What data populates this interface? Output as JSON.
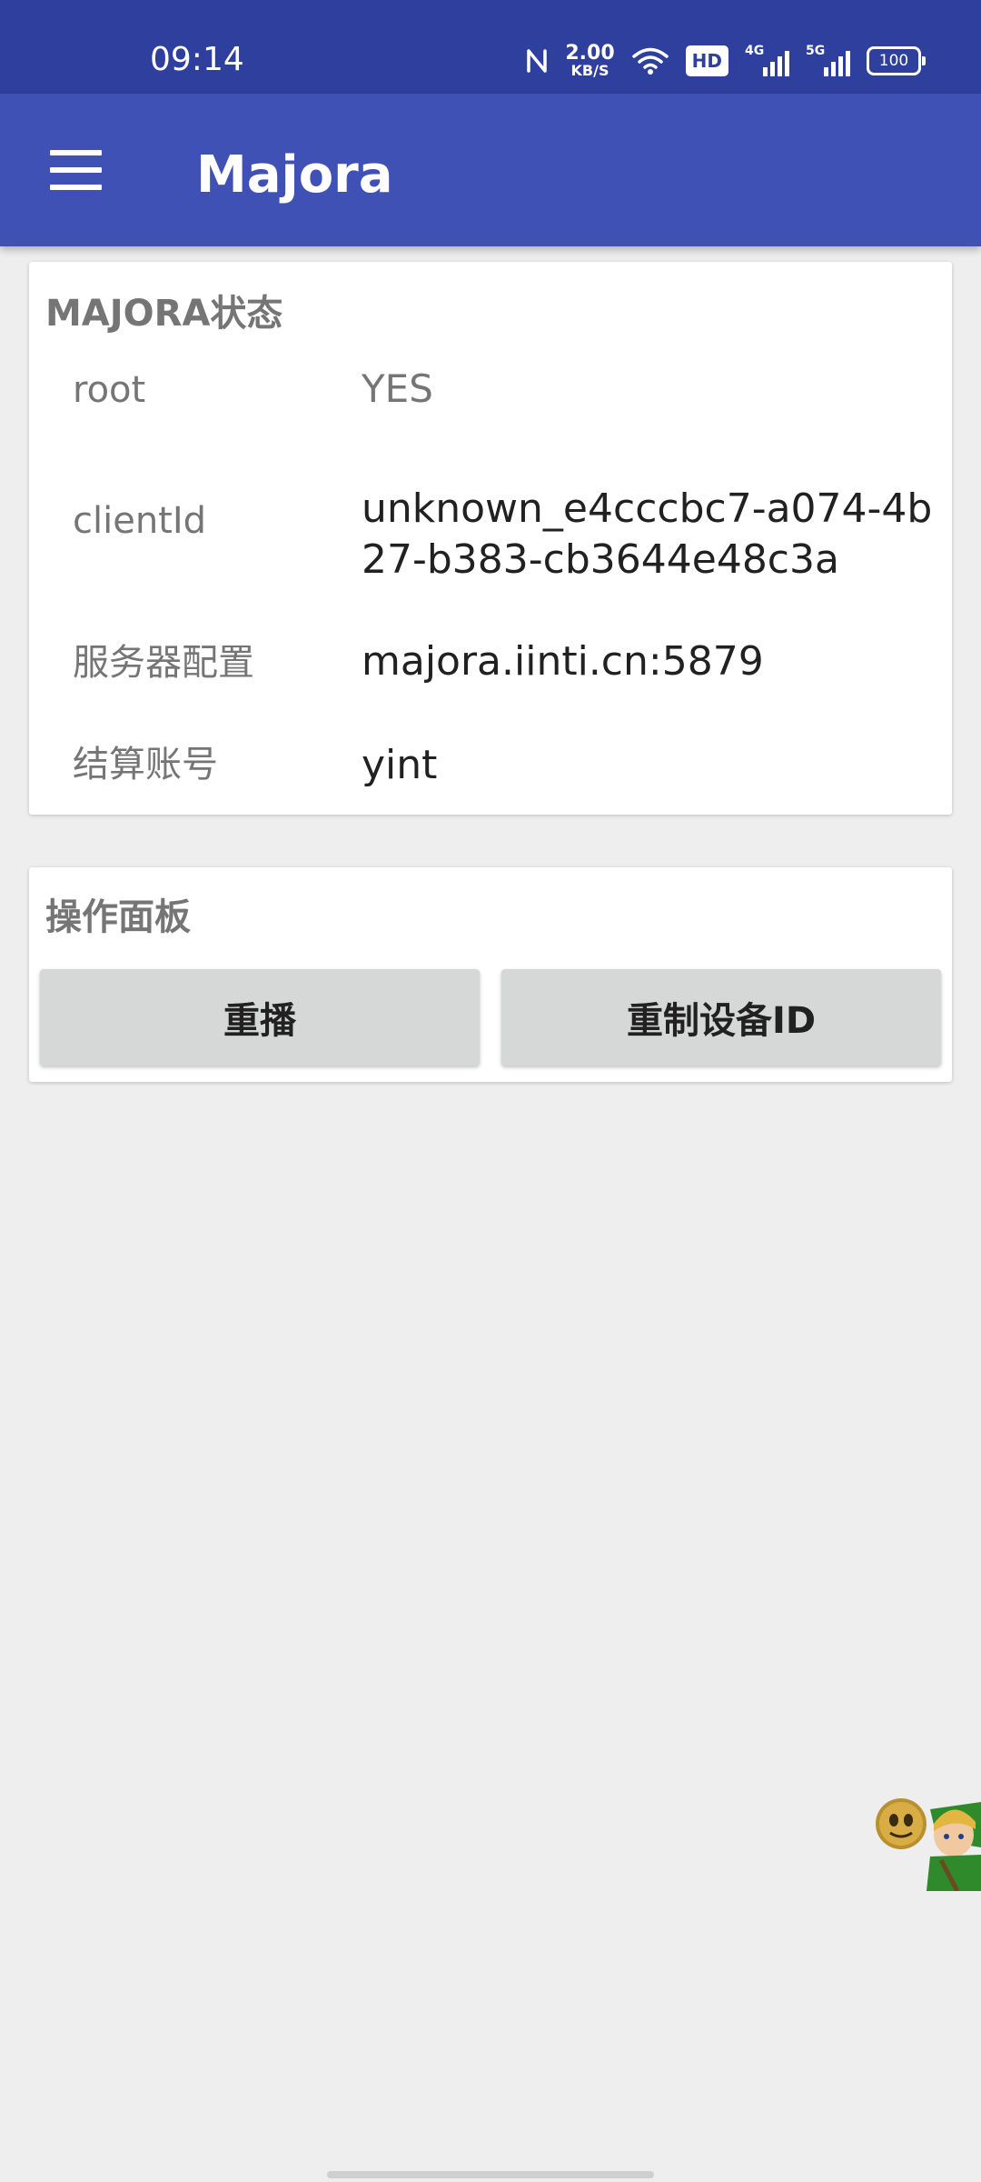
{
  "status_bar": {
    "time": "09:14",
    "net_speed_value": "2.00",
    "net_speed_unit": "KB/S",
    "hd_label": "HD",
    "net_type_1": "4G",
    "net_type_2": "5G",
    "battery": "100"
  },
  "app_bar": {
    "title": "Majora",
    "menu_icon": "hamburger-menu-icon"
  },
  "status_card": {
    "title": "MAJORA状态",
    "rows": [
      {
        "label": "root",
        "value": "YES"
      },
      {
        "label": "clientId",
        "value": "unknown_e4cccbc7-a074-4b27-b383-cb3644e48c3a"
      },
      {
        "label": "服务器配置",
        "value": "majora.iinti.cn:5879"
      },
      {
        "label": "结算账号",
        "value": "yint"
      }
    ]
  },
  "panel_card": {
    "title": "操作面板",
    "replay_button": "重播",
    "reset_device_button": "重制设备ID"
  },
  "colors": {
    "status_bar": "#2e3f9e",
    "app_bar": "#3f51b5",
    "background": "#eeeeee",
    "button": "#d6d7d7"
  }
}
